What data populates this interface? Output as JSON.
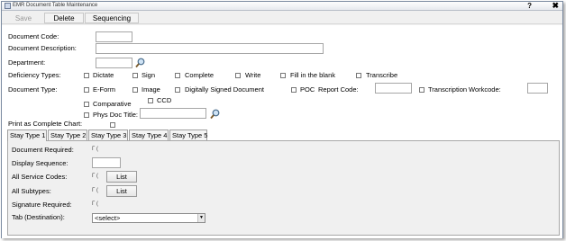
{
  "window": {
    "title": "EMR Document Table Maintenance",
    "help": "?",
    "close": "✖"
  },
  "toolbar": {
    "save": "Save",
    "delete": "Delete",
    "sequencing": "Sequencing"
  },
  "form": {
    "document_code": {
      "label": "Document Code:",
      "value": ""
    },
    "document_description": {
      "label": "Document Description:",
      "value": ""
    },
    "department": {
      "label": "Department:",
      "value": ""
    },
    "deficiency_types": {
      "label": "Deficiency Types:",
      "options": [
        "Dictate",
        "Sign",
        "Complete",
        "Write",
        "Fill in the blank",
        "Transcribe"
      ]
    },
    "document_type": {
      "label": "Document Type:",
      "options": [
        "E-Form",
        "Image",
        "Digitally Signed Document",
        "POC",
        "Transcription"
      ],
      "report_code_label": "Report Code:",
      "workcode_label": "Workcode:",
      "row2": [
        "Comparative",
        "CCD"
      ],
      "phys_doc_title": "Phys Doc Title:"
    },
    "print_as_complete_chart": "Print as Complete Chart:"
  },
  "tabs": [
    "Stay Type 1",
    "Stay Type 2",
    "Stay Type 3",
    "Stay Type 4",
    "Stay Type 5"
  ],
  "panel": {
    "document_required": "Document Required:",
    "display_sequence": "Display Sequence:",
    "all_service_codes": "All Service Codes:",
    "all_subtypes": "All Subtypes:",
    "signature_required": "Signature Required:",
    "tab_destination": "Tab (Destination):",
    "list_button": "List",
    "tab_destination_value": "<select>",
    "checkbox_suffix": "(",
    "check_mark": "Γ"
  }
}
